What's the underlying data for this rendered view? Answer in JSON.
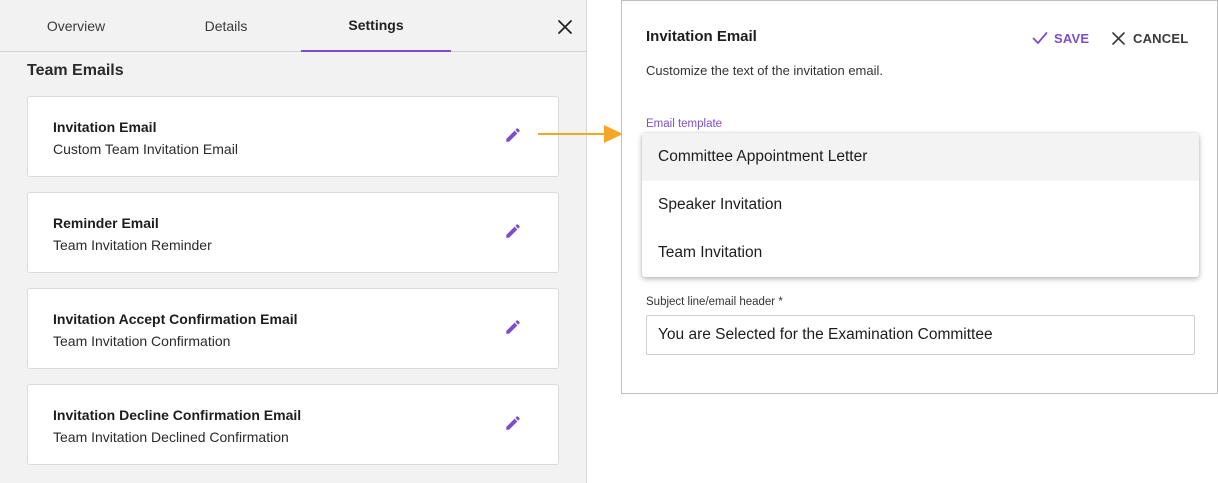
{
  "tabs": [
    {
      "label": "Overview"
    },
    {
      "label": "Details"
    },
    {
      "label": "Settings"
    }
  ],
  "active_tab": "Settings",
  "section_title": "Team Emails",
  "cards": [
    {
      "title": "Invitation Email",
      "subtitle": "Custom Team Invitation Email"
    },
    {
      "title": "Reminder Email",
      "subtitle": "Team Invitation Reminder"
    },
    {
      "title": "Invitation Accept Confirmation Email",
      "subtitle": "Team Invitation Confirmation"
    },
    {
      "title": "Invitation Decline Confirmation Email",
      "subtitle": "Team Invitation Declined Confirmation"
    }
  ],
  "icons": {
    "close": "close-icon",
    "edit": "pencil-icon",
    "save": "check-icon",
    "cancel": "close-icon",
    "arrow": "arrow-right-icon"
  },
  "colors": {
    "accent": "#7b4fc9",
    "arrow": "#f5a623",
    "panel_bg": "#f2f2f2"
  },
  "dialog": {
    "title": "Invitation Email",
    "save_label": "SAVE",
    "cancel_label": "CANCEL",
    "description": "Customize the text of the invitation email.",
    "template_label": "Email template",
    "template_options": [
      {
        "label": "Committee Appointment Letter"
      },
      {
        "label": "Speaker Invitation"
      },
      {
        "label": "Team Invitation"
      }
    ],
    "highlighted_option": "Committee Appointment Letter",
    "subject_label": "Subject line/email header *",
    "subject_value": "You are Selected for the Examination Committee"
  }
}
